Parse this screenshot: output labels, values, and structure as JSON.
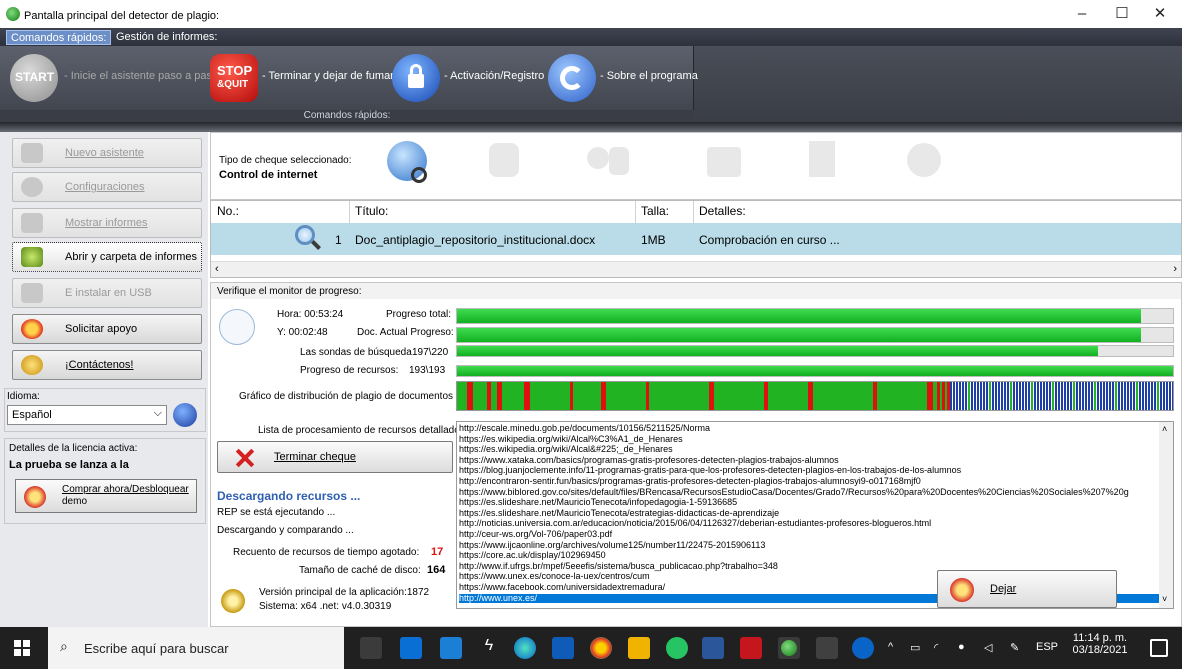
{
  "window": {
    "title": "Pantalla principal del detector de plagio:",
    "controls": [
      "–",
      "☐",
      "✕"
    ]
  },
  "ribbon": {
    "tabs": [
      {
        "label": "Comandos rápidos:",
        "active": true
      },
      {
        "label": "Gestión de informes:",
        "active": false
      }
    ],
    "buttons": {
      "start": {
        "icon_text": "START",
        "label": "- Inicie el asistente paso a paso"
      },
      "stop": {
        "icon_text_1": "STOP",
        "icon_text_2": "&QUIT",
        "label": "- Terminar y dejar de fumar"
      },
      "activation": {
        "label": "- Activación/Registro"
      },
      "about": {
        "label": "- Sobre el programa"
      }
    },
    "group_label": "Comandos rápidos:"
  },
  "sidebar": {
    "items": [
      {
        "label": "Nuevo asistente",
        "enabled": false
      },
      {
        "label": "Configuraciones",
        "enabled": false
      },
      {
        "label": "Mostrar informes",
        "enabled": false
      },
      {
        "label": "Abrir y carpeta de informes",
        "enabled": true
      },
      {
        "label": "E instalar en USB",
        "enabled": false
      },
      {
        "label": "Solicitar apoyo",
        "enabled": true
      },
      {
        "label": "¡Contáctenos!",
        "enabled": true
      }
    ],
    "language_label": "Idioma:",
    "language_value": "Español",
    "license_label": "Detalles de la licencia activa:",
    "license_value": "La prueba se lanza a la",
    "buy_label_1": "Comprar ahora/Desbloquear",
    "buy_label_2": "demo"
  },
  "check": {
    "type_label": "Tipo de cheque seleccionado:",
    "type_value": "Control de internet"
  },
  "table": {
    "headers": [
      "No.:",
      "Título:",
      "Talla:",
      "Detalles:"
    ],
    "rows": [
      {
        "no": "1",
        "title": "Doc_antiplagio_repositorio_institucional.docx",
        "size": "1MB",
        "details": "Comprobación en curso ..."
      }
    ]
  },
  "monitor": {
    "title": "Verifique el monitor de progreso:",
    "hora": "Hora: 00:53:24",
    "y": "Y: 00:02:48",
    "total_label": "Progreso total:",
    "doc_label": "Doc. Actual Progreso:",
    "probes_label": "Las sondas de búsqueda",
    "probes_value": "197\\220",
    "resources_label": "Progreso de recursos:",
    "resources_value": "193\\193",
    "progress": {
      "total": 0.955,
      "doc": 0.955,
      "probes": 0.895,
      "resources": 1.0
    },
    "dist_label": "Gráfico de distribución de plagio de documentos",
    "list_label": "Lista de procesamiento de recursos detallados:",
    "stop_button": "Terminar cheque",
    "downloading": "Descargando recursos ...",
    "rep_running": "REP se está ejecutando ...",
    "downloading_comparing": "Descargando y comparando ...",
    "timeout_label": "Recuento de recursos de tiempo agotado:",
    "timeout_value": "17",
    "cache_label": "Tamaño de caché de disco:",
    "cache_value": "164",
    "version": "Versión principal de la aplicación:1872",
    "system": "Sistema: x64 .net: v4.0.30319",
    "leave_button": "Dejar",
    "urls": [
      "http://escale.minedu.gob.pe/documents/10156/5211525/Norma",
      "https://es.wikipedia.org/wiki/Alcal%C3%A1_de_Henares",
      "https://es.wikipedia.org/wiki/Alcal&#225;_de_Henares",
      "https://www.xataka.com/basics/programas-gratis-profesores-detecten-plagios-trabajos-alumnos",
      "https://blog.juanjoclemente.info/11-programas-gratis-para-que-los-profesores-detecten-plagios-en-los-trabajos-de-los-alumnos",
      "http://encontraron-sentir.fun/basics/programas-gratis-profesores-detecten-plagios-trabajos-alumnosyi9-o017168mjf0",
      "https://www.biblored.gov.co/sites/default/files/BRencasa/RecursosEstudioCasa/Docentes/Grado7/Recursos%20para%20Docentes%20Ciencias%20Sociales%207%20g",
      "https://es.slideshare.net/MauricioTenecota/infopedagogia-1-59136685",
      "https://es.slideshare.net/MauricioTenecota/estrategias-didacticas-de-aprendizaje",
      "http://noticias.universia.com.ar/educacion/noticia/2015/06/04/1126327/deberian-estudiantes-profesores-blogueros.html",
      "http://ceur-ws.org/Vol-706/paper03.pdf",
      "https://www.ijcaonline.org/archives/volume125/number11/22475-2015906113",
      "https://core.ac.uk/display/102969450",
      "http://www.if.ufrgs.br/mpef/5eeefis/sistema/busca_publicacao.php?trabalho=348",
      "https://www.unex.es/conoce-la-uex/centros/cum",
      "https://www.facebook.com/universidadextremadura/",
      "http://www.unex.es/"
    ],
    "selected_url_index": 16
  },
  "taskbar": {
    "search_placeholder": "Escribe aquí para buscar",
    "lang": "ESP",
    "time": "11:14 p. m.",
    "date": "03/18/2021"
  },
  "colors": {
    "plagio": "#e01010",
    "ok": "#21b321",
    "accent_blue": "#0078d7",
    "selected_row": "#b9dce8"
  }
}
